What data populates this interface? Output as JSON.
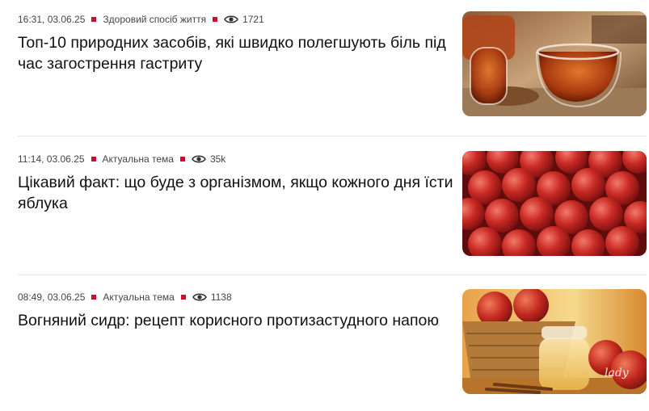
{
  "articles": [
    {
      "time": "16:31, 03.06.25",
      "category": "Здоровий спосіб життя",
      "views": "1721",
      "title": "Топ-10 природних засобів, які швидко полегшують біль під час загострення гастриту",
      "image": "tea-cups-photo"
    },
    {
      "time": "11:14, 03.06.25",
      "category": "Актуальна тема",
      "views": "35k",
      "title": "Цікавий факт: що буде з організмом, якщо кожного дня їсти яблука",
      "image": "red-apples-photo"
    },
    {
      "time": "08:49, 03.06.25",
      "category": "Актуальна тема",
      "views": "1138",
      "title": "Вогняний сидр: рецепт корисного протизастудного напою",
      "image": "apple-cider-photo",
      "watermark": "lady"
    }
  ],
  "colors": {
    "accent": "#c8102e",
    "text": "#111111",
    "meta": "#444444",
    "divider": "#e6e6e6"
  },
  "icons": {
    "separator": "red-square-icon",
    "views": "eye-icon"
  }
}
